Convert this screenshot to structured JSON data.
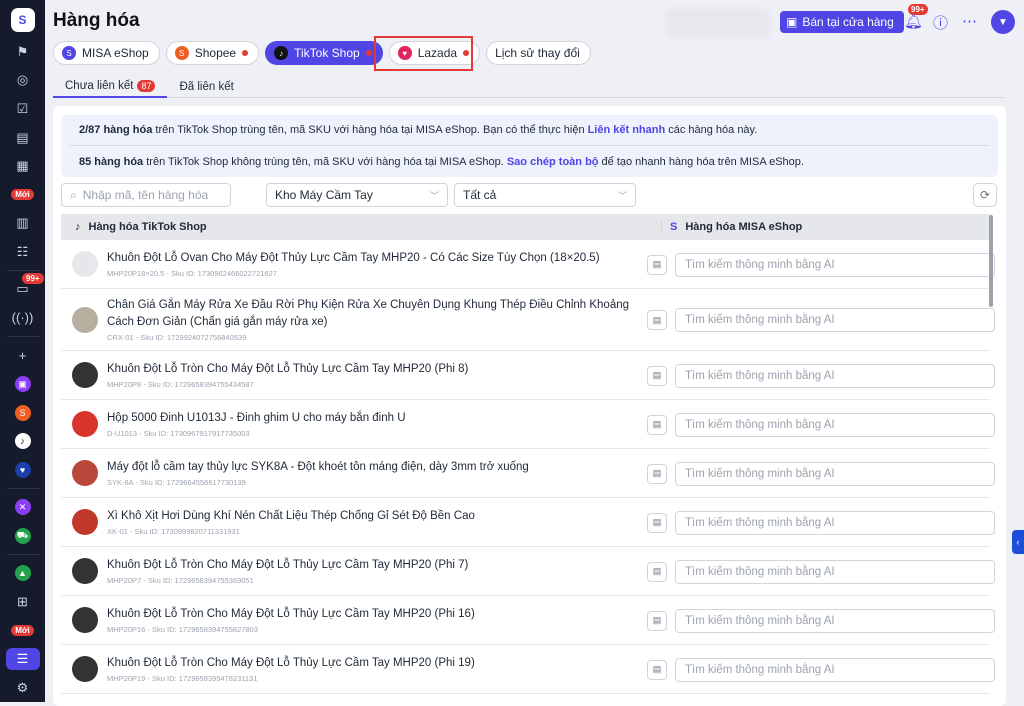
{
  "header": {
    "title": "Hàng hóa",
    "pos_button": "Bán tại cửa hàng",
    "notification_count": "99+"
  },
  "sidebar": {
    "badge_new": "Mới",
    "chat_count": "99+"
  },
  "channels": [
    {
      "label": "MISA eShop",
      "color": "#4f46e5",
      "dot": false
    },
    {
      "label": "Shopee",
      "color": "#f05d23",
      "dot": true
    },
    {
      "label": "TikTok Shop",
      "color": "#111111",
      "dot": true,
      "active": true
    },
    {
      "label": "Lazada",
      "color": "#e0245e",
      "dot": true
    },
    {
      "label": "Lịch sử thay đổi",
      "dot": false
    }
  ],
  "subtabs": {
    "unlinked": "Chưa liên kết",
    "unlinked_count": "87",
    "linked": "Đã liên kết"
  },
  "info": {
    "l1_bold": "2/87 hàng hóa",
    "l1_text": "trên TikTok Shop trùng tên, mã SKU với hàng hóa tại MISA eShop. Bạn có thể thực hiện",
    "l1_link": "Liên kết nhanh",
    "l1_end": "các hàng hóa này.",
    "l2_bold": "85 hàng hóa",
    "l2_text": "trên TikTok Shop không trùng tên, mã SKU với hàng hóa tại MISA eShop.",
    "l2_link": "Sao chép toàn bộ",
    "l2_end": "để tạo nhanh hàng hóa trên MISA eShop."
  },
  "filters": {
    "search_placeholder": "Nhập mã, tên hàng hóa",
    "warehouse": "Kho Máy Cầm Tay",
    "status": "Tất cả"
  },
  "table": {
    "col1": "Hàng hóa TikTok Shop",
    "col2": "Hàng hóa MISA eShop",
    "ai_placeholder": "Tìm kiếm thông minh bằng AI",
    "rows": [
      {
        "name": "Khuôn Đột Lỗ Ovan Cho Máy Đột Thủy Lực Cầm Tay MHP20 - Có Các Size Tùy Chọn (18×20.5)",
        "meta": "MHP20P18×20.5 - Sku ID: 1730962466022721627",
        "img": "#e5e7eb"
      },
      {
        "name": "Chân Giá Gắn Máy Rửa Xe Đầu Rời Phụ Kiện Rửa Xe Chuyên Dụng Khung Thép Điều Chỉnh Khoảng Cách Đơn Giản (Chấn giá gắn máy rửa xe)",
        "meta": "CRX-01 - Sku ID: 1729924072756840539",
        "img": "#b8aea0"
      },
      {
        "name": "Khuôn Đột Lỗ Tròn Cho Máy Đột Lỗ Thủy Lực Cầm Tay MHP20 (Phi 8)",
        "meta": "MHP20P8 - Sku ID: 1729658394755434587",
        "img": "#333"
      },
      {
        "name": "Hộp 5000 Đinh U1013J - Đinh ghim U cho máy bắn đinh U",
        "meta": "D-U1013 - Sku ID: 1730967917917735003",
        "img": "#d9342b"
      },
      {
        "name": "Máy đột lỗ cầm tay thủy lực SYK8A - Đột khoét tôn máng điện, dày 3mm trở xuống",
        "meta": "SYK-8A - Sku ID: 1729664556617730139",
        "img": "#b9473a"
      },
      {
        "name": "Xì Khô Xịt Hơi Dùng Khí Nén Chất Liệu Thép Chống Gỉ Sét Độ Bền Cao",
        "meta": "XK-01 - Sku ID: 1730999820711331931",
        "img": "#c0392b"
      },
      {
        "name": "Khuôn Đột Lỗ Tròn Cho Máy Đột Lỗ Thủy Lực Cầm Tay MHP20 (Phi 7)",
        "meta": "MHP20P7 - Sku ID: 1729658394755369051",
        "img": "#333"
      },
      {
        "name": "Khuôn Đột Lỗ Tròn Cho Máy Đột Lỗ Thủy Lực Cầm Tay MHP20 (Phi 16)",
        "meta": "MHP20P16 - Sku ID: 1729658394755827803",
        "img": "#333"
      },
      {
        "name": "Khuôn Đột Lỗ Tròn Cho Máy Đột Lỗ Thủy Lực Cầm Tay MHP20 (Phi 19)",
        "meta": "MHP20P19 - Sku ID: 1729658395478231131",
        "img": "#333"
      }
    ]
  }
}
